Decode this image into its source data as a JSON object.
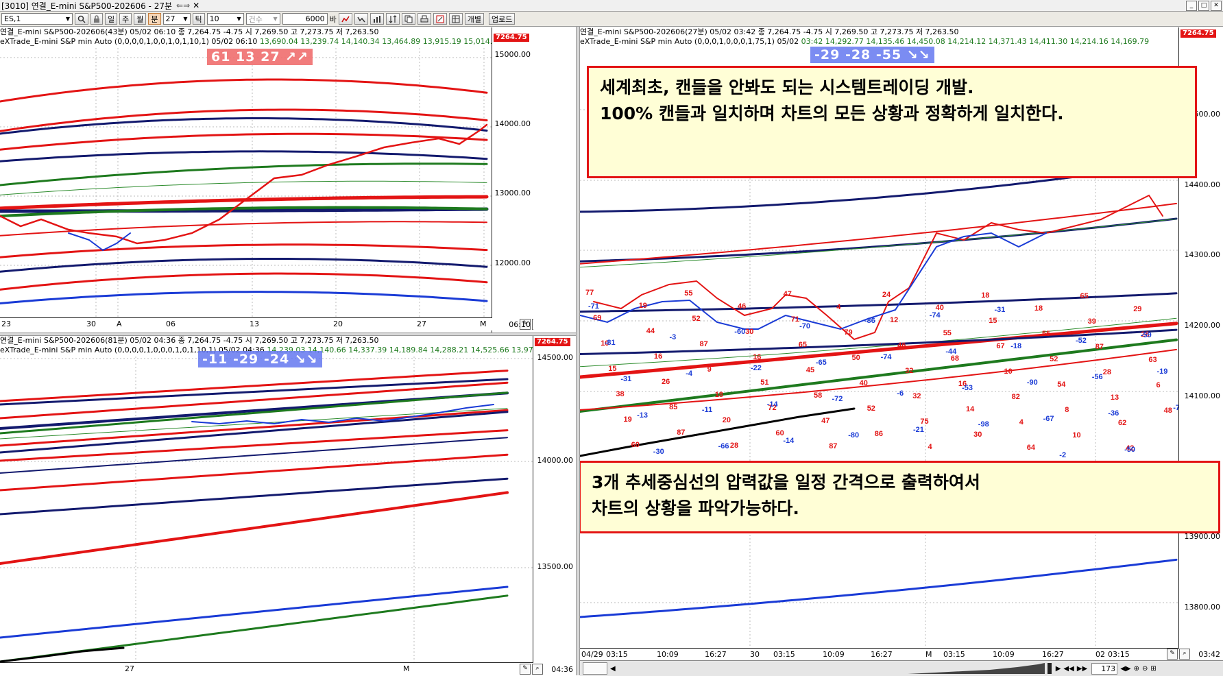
{
  "window": {
    "title": "[3010] 연결_E-mini S&P500-202606 - 27분",
    "title_icons": "⇐⇒",
    "close_glyph": "✕",
    "ctrl_min": "_",
    "ctrl_max": "□",
    "ctrl_close": "✕"
  },
  "toolbar": {
    "symbol": "ES,1",
    "btn_day": "일",
    "btn_week": "주",
    "btn_month": "월",
    "btn_min": "분",
    "interval": "27",
    "btn_tick": "틱",
    "count": "10",
    "qty_label": "건수",
    "qty_value": "6000",
    "bar_label": "바",
    "btn_individual": "개별",
    "btn_upload": "업로드",
    "dropdown_glyph": "▼"
  },
  "panels": {
    "top_left": {
      "header1": "연결_E-mini S&P500-202606(43분) 05/02 06:10   종 7,264.75  -4.75    시 7,269.50  고 7,273.75  저 7,263.50",
      "header2_label": "eXTrade_E-mini S&P min Auto  (0,0,0,0,1,0,0,1,0,1,10,1) 05/02 06:10",
      "header2_values": "13,690.04  13,239.74  14,140.34  13,464.89  13,915.19  15,014.99  12,83",
      "price_tag": "7264.75",
      "badge": "61  13  27 ↗↗",
      "y_ticks": [
        "15000.00",
        "14000.00",
        "13000.00",
        "12000.00"
      ],
      "x_ticks": [
        "23",
        "30",
        "A",
        "06",
        "13",
        "20",
        "27",
        "M"
      ],
      "time": "06:10"
    },
    "bottom_left": {
      "header1": "연결_E-mini S&P500-202606(81분) 05/02 04:36   종 7,264.75  -4.75    시 7,269.50  고 7,273.75  저 7,263.50",
      "header2_label": "eXTrade_E-mini S&P min Auto  (0,0,0,0,1,0,0,0,1,0,1,10,1) 05/02 04:36",
      "header2_values": "14,239.03  14,140.66  14,337.39  14,189.84  14,288.21  14,525.66  13,97",
      "price_tag": "7264.75",
      "badge": "-11  -29  -24 ↘↘",
      "y_ticks": [
        "14500.00",
        "14000.00",
        "13500.00"
      ],
      "x_ticks": [
        "27",
        "M"
      ],
      "time": "04:36"
    },
    "right": {
      "header1": "연결_E-mini S&P500-202606(27분) 05/02 03:42   종 7,264.75  -4.75    시 7,269.50  고 7,273.75  저 7,263.50",
      "header2_label": "eXTrade_E-mini S&P min Auto  (0,0,0,1,0,0,0,1,75,1) 05/02",
      "header2_values": "03:42  14,292.77  14,135.46  14,450.08  14,214.12  14,371.43  14,411.30  14,214.16  14,169.79",
      "price_tag": "7264.75",
      "badge": "-29  -28  -55 ↘↘",
      "y_ticks": [
        "14500.00",
        "14400.00",
        "14300.00",
        "14200.00",
        "14100.00",
        "14000.00",
        "13900.00",
        "13800.00"
      ],
      "x_ticks": [
        "04/29",
        "03:15",
        "10:09",
        "16:27",
        "30",
        "03:15",
        "10:09",
        "16:27",
        "M",
        "03:15",
        "10:09",
        "16:27",
        "02",
        "03:15"
      ],
      "time": "03:42",
      "callout_top_line1": "세계최초, 캔들을 안봐도 되는 시스템트레이딩 개발.",
      "callout_top_line2": "100% 캔들과 일치하며 차트의 모든 상황과 정확하게 일치한다.",
      "callout_bottom_line1": "3개 추세중심선의 압력값을 일정 간격으로 출력하여서",
      "callout_bottom_line2": "차트의 상황을 파악가능하다.",
      "red_labels": [
        "77",
        "69",
        "10",
        "15",
        "38",
        "19",
        "60",
        "19",
        "44",
        "16",
        "26",
        "85",
        "87",
        "55",
        "52",
        "87",
        "9",
        "18",
        "20",
        "28",
        "46",
        "30",
        "16",
        "51",
        "72",
        "60",
        "47",
        "71",
        "65",
        "45",
        "58",
        "47",
        "87",
        "4",
        "79",
        "50",
        "40",
        "52",
        "86",
        "24",
        "12",
        "46",
        "32",
        "32",
        "75",
        "4",
        "40",
        "55",
        "68",
        "16",
        "14",
        "30",
        "18",
        "15",
        "67",
        "10",
        "82",
        "4",
        "64",
        "18",
        "55",
        "52",
        "54",
        "8",
        "10",
        "65",
        "39",
        "87",
        "28",
        "13",
        "62",
        "42",
        "29",
        "28",
        "63",
        "6",
        "48"
      ],
      "blue_labels": [
        "-71",
        "-81",
        "-31",
        "-13",
        "-30",
        "-3",
        "-4",
        "-11",
        "-66",
        "-60",
        "-22",
        "-14",
        "-14",
        "-70",
        "-65",
        "-72",
        "-80",
        "-86",
        "-74",
        "-6",
        "-21",
        "-74",
        "-44",
        "-53",
        "-98",
        "-31",
        "-18",
        "-90",
        "-67",
        "-2",
        "-52",
        "-56",
        "-36",
        "-50",
        "-59",
        "-19",
        "-71"
      ]
    }
  },
  "statusbar": {
    "page_count": "173"
  },
  "colors": {
    "red": "#e31414",
    "blue": "#1a3bd6",
    "navy": "#131a6e",
    "green": "#1e7a1e",
    "thin_green": "#2d8c2d",
    "callout_bg": "#fffed6",
    "badge_red": "#f06e6e",
    "badge_blue": "#6478f0"
  }
}
